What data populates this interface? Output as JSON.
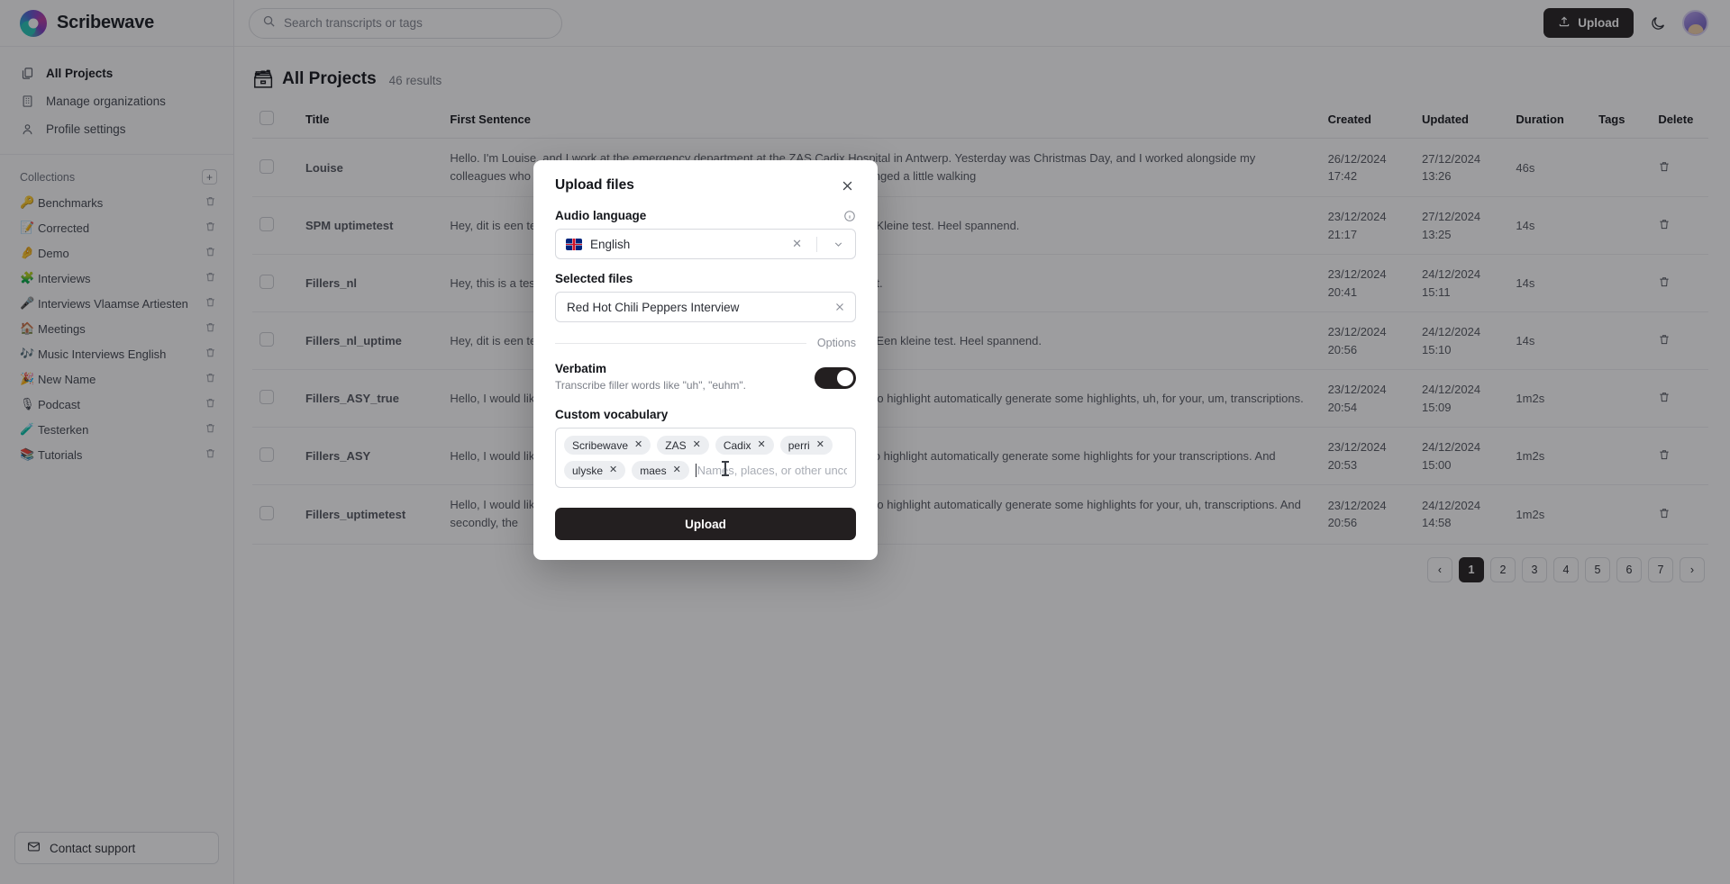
{
  "brand": {
    "name": "Scribewave"
  },
  "sidebar": {
    "nav": [
      {
        "label": "All Projects",
        "icon": "documents-icon",
        "active": true
      },
      {
        "label": "Manage organizations",
        "icon": "building-icon",
        "active": false
      },
      {
        "label": "Profile settings",
        "icon": "user-icon",
        "active": false
      }
    ],
    "collections_title": "Collections",
    "add_collection_label": "+",
    "collections": [
      {
        "emoji": "🔑",
        "label": "Benchmarks"
      },
      {
        "emoji": "📝",
        "label": "Corrected"
      },
      {
        "emoji": "🤌",
        "label": "Demo"
      },
      {
        "emoji": "🧩",
        "label": "Interviews"
      },
      {
        "emoji": "🎤",
        "label": "Interviews Vlaamse Artiesten"
      },
      {
        "emoji": "🏠",
        "label": "Meetings"
      },
      {
        "emoji": "🎶",
        "label": "Music Interviews English"
      },
      {
        "emoji": "🎉",
        "label": "New Name"
      },
      {
        "emoji": "🎙",
        "label": "Podcast"
      },
      {
        "emoji": "🧪",
        "label": "Testerken"
      },
      {
        "emoji": "📚",
        "label": "Tutorials"
      }
    ],
    "support_label": "Contact support"
  },
  "topbar": {
    "search_placeholder": "Search transcripts or tags",
    "upload_label": "Upload"
  },
  "main": {
    "page_emoji": "🗃",
    "page_title": "All Projects",
    "results_count": "46 results",
    "columns": [
      "Title",
      "First Sentence",
      "Created",
      "Updated",
      "Duration",
      "Tags",
      "Delete"
    ],
    "rows": [
      {
        "title": "Louise",
        "first_sentence": "Hello. I'm Louise, and I work at the emergency department at the ZAS Cadix Hospital in Antwerp. Yesterday was Christmas Day, and I worked alongside my colleagues who were busy tending to many sick patients. It was hectic, so we arranged a little walking",
        "created": "26/12/2024 17:42",
        "updated": "27/12/2024 13:26",
        "duration": "46s"
      },
      {
        "title": "SPM uptimetest",
        "first_sentence": "Hey, dit is een test om te kijken of alles goed verwerkt worden met Speechmatics. Kleine test. Heel spannend.",
        "created": "23/12/2024 21:17",
        "updated": "27/12/2024 13:25",
        "duration": "14s"
      },
      {
        "title": "Fillers_nl",
        "first_sentence": "Hey, this is a test on the greatest worden met Speechmatics clementist hills panant.",
        "created": "23/12/2024 20:41",
        "updated": "24/12/2024 15:11",
        "duration": "14s"
      },
      {
        "title": "Fillers_nl_uptime",
        "first_sentence": "Hey, dit is een test om te kijken of alles goed verwerkt worden met Speechmatics! Een kleine test. Heel spannend.",
        "created": "23/12/2024 20:56",
        "updated": "24/12/2024 15:10",
        "duration": "14s"
      },
      {
        "title": "Fillers_ASY_true",
        "first_sentence": "Hello, I would like to tell you about Scribewave, a very nice, tool which allows you to highlight automatically generate some highlights, uh, for your, um, transcriptions.",
        "created": "23/12/2024 20:54",
        "updated": "24/12/2024 15:09",
        "duration": "1m2s"
      },
      {
        "title": "Fillers_ASY",
        "first_sentence": "Hello, I would like to tell you about Scribewave, a very nice tool which allows you to highlight automatically generate some highlights for your transcriptions. And",
        "created": "23/12/2024 20:53",
        "updated": "24/12/2024 15:00",
        "duration": "1m2s"
      },
      {
        "title": "Fillers_uptimetest",
        "first_sentence": "Hello, I would like to tell you about Scribewave, a very nice, tool which allows you to highlight automatically generate some highlights for your, uh, transcriptions. And secondly, the",
        "created": "23/12/2024 20:56",
        "updated": "24/12/2024 14:58",
        "duration": "1m2s"
      }
    ],
    "pagination": {
      "prev": "‹",
      "next": "›",
      "pages": [
        "1",
        "2",
        "3",
        "4",
        "5",
        "6",
        "7"
      ],
      "current": "1"
    }
  },
  "modal": {
    "title": "Upload files",
    "close_label": "✕",
    "audio_language_label": "Audio language",
    "language_value": "English",
    "language_flag": "uk-flag-icon",
    "selected_files_label": "Selected files",
    "selected_file": "Red Hot Chili Peppers Interview",
    "options_divider_label": "Options",
    "verbatim_title": "Verbatim",
    "verbatim_sub": "Transcribe filler words like \"uh\", \"euhm\".",
    "verbatim_on": true,
    "vocabulary_label": "Custom vocabulary",
    "vocabulary_chips": [
      "Scribewave",
      "ZAS",
      "Cadix",
      "perri",
      "ulyske",
      "maes"
    ],
    "vocabulary_placeholder": "Names, places, or other uncommon",
    "submit_label": "Upload"
  },
  "colors": {
    "accent": "#231f20",
    "surface": "#ffffff",
    "sidebar": "#fbfbfc",
    "chip": "#eceef1"
  }
}
